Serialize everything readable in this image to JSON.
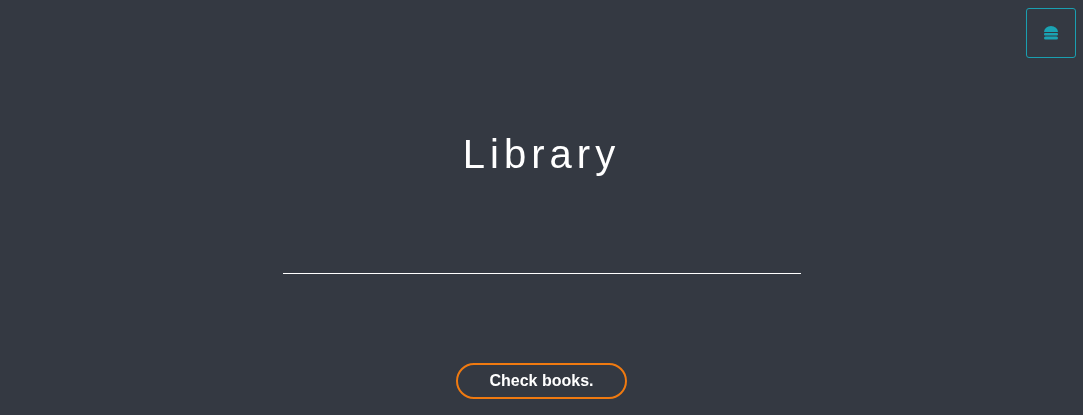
{
  "title": "Library",
  "button": {
    "label": "Check books."
  }
}
